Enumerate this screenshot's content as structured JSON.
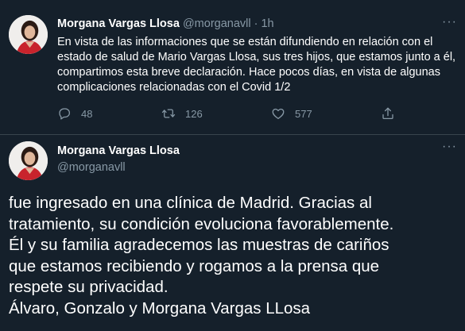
{
  "tweet1": {
    "name": "Morgana Vargas Llosa",
    "handle": "@morganavll",
    "time": "· 1h",
    "more_label": "···",
    "text": "En vista de las informaciones que se están difundiendo en relación con el estado de salud de Mario Vargas Llosa, sus tres hijos, que estamos junto a él, compartimos esta breve declaración. Hace pocos días, en vista de algunas complicaciones relacionadas con el Covid 1/2",
    "replies": "48",
    "retweets": "126",
    "likes": "577"
  },
  "tweet2": {
    "name": "Morgana Vargas Llosa",
    "handle": "@morganavll",
    "more_label": "···",
    "text_lines": [
      "fue ingresado en una clínica de Madrid. Gracias al",
      "tratamiento, su condición evoluciona favorablemente.",
      "Él y su familia agradecemos las muestras de cariños",
      "que estamos recibiendo y rogamos a la prensa que",
      "respete su privacidad.",
      "Álvaro, Gonzalo y Morgana Vargas LLosa"
    ]
  },
  "icons": {
    "reply": "reply-icon",
    "retweet": "retweet-icon",
    "like": "heart-icon",
    "share": "share-icon",
    "more": "more-icon"
  },
  "colors": {
    "background": "#15202b",
    "secondary_text": "#8899a6",
    "divider": "#38444d",
    "primary_text": "#ffffff"
  }
}
